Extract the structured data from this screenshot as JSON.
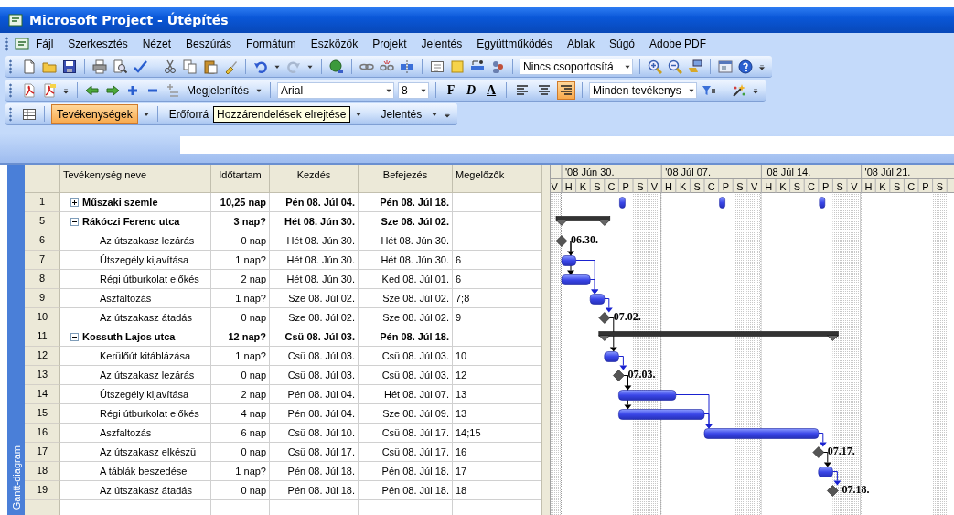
{
  "window": {
    "title": "Microsoft Project - Útépítés"
  },
  "menu": [
    "Fájl",
    "Szerkesztés",
    "Nézet",
    "Beszúrás",
    "Formátum",
    "Eszközök",
    "Projekt",
    "Jelentés",
    "Együttműködés",
    "Ablak",
    "Súgó",
    "Adobe PDF"
  ],
  "toolbar_standard": {
    "grouping": "Nincs csoportosítá"
  },
  "toolbar_formatting": {
    "show_button": "Megjelenítés",
    "font": "Arial",
    "size": "8",
    "style_buttons": [
      "F",
      "D",
      "A"
    ],
    "align_buttons": [
      {
        "selected": false
      },
      {
        "selected": false
      },
      {
        "selected": true
      }
    ],
    "filter": "Minden tevékenys"
  },
  "toolbar_views": {
    "tabs": [
      {
        "label": "Tevékenységek",
        "selected": true
      },
      {
        "label": "Erőforrá",
        "selected": false
      },
      {
        "label": "Jelentés",
        "selected": false
      }
    ],
    "tooltip": "Hozzárendelések elrejtése"
  },
  "view_bar": {
    "label": "Gantt-diagram"
  },
  "table": {
    "columns": [
      "Tevékenység neve",
      "Időtartam",
      "Kezdés",
      "Befejezés",
      "Megelőzők"
    ],
    "rows": [
      {
        "id": "1",
        "kind": "recurring",
        "expanded": false,
        "name": "Műszaki szemle",
        "duration": "10,25 nap",
        "start": "Pén 08. Júl 04.",
        "finish": "Pén 08. Júl 18."
      },
      {
        "id": "5",
        "kind": "summary",
        "expanded": true,
        "name": "Rákóczi Ferenc utca",
        "duration": "3 nap?",
        "start": "Hét 08. Jún 30.",
        "finish": "Sze 08. Júl 02."
      },
      {
        "id": "6",
        "kind": "milestone",
        "name": "Az útszakasz lezárás",
        "duration": "0 nap",
        "start": "Hét 08. Jún 30.",
        "finish": "Hét 08. Jún 30.",
        "label": "06.30."
      },
      {
        "id": "7",
        "kind": "task",
        "name": "Útszegély kijavítása",
        "duration": "1 nap?",
        "start": "Hét 08. Jún 30.",
        "finish": "Hét 08. Jún 30.",
        "predecessors": "6"
      },
      {
        "id": "8",
        "kind": "task",
        "name": "Régi útburkolat előkés",
        "duration": "2 nap",
        "start": "Hét 08. Jún 30.",
        "finish": "Ked 08. Júl 01.",
        "predecessors": "6"
      },
      {
        "id": "9",
        "kind": "task",
        "name": "Aszfaltozás",
        "duration": "1 nap?",
        "start": "Sze 08. Júl 02.",
        "finish": "Sze 08. Júl 02.",
        "predecessors": "7;8"
      },
      {
        "id": "10",
        "kind": "milestone",
        "name": "Az útszakasz átadás",
        "duration": "0 nap",
        "start": "Sze 08. Júl 02.",
        "finish": "Sze 08. Júl 02.",
        "predecessors": "9",
        "label": "07.02."
      },
      {
        "id": "11",
        "kind": "summary",
        "expanded": true,
        "name": "Kossuth Lajos utca",
        "duration": "12 nap?",
        "start": "Csü 08. Júl 03.",
        "finish": "Pén 08. Júl 18."
      },
      {
        "id": "12",
        "kind": "task",
        "name": "Kerülőút kitáblázása",
        "duration": "1 nap?",
        "start": "Csü 08. Júl 03.",
        "finish": "Csü 08. Júl 03.",
        "predecessors": "10"
      },
      {
        "id": "13",
        "kind": "milestone",
        "name": "Az útszakasz lezárás",
        "duration": "0 nap",
        "start": "Csü 08. Júl 03.",
        "finish": "Csü 08. Júl 03.",
        "predecessors": "12",
        "label": "07.03."
      },
      {
        "id": "14",
        "kind": "task",
        "name": "Útszegély kijavítása",
        "duration": "2 nap",
        "start": "Pén 08. Júl 04.",
        "finish": "Hét 08. Júl 07.",
        "predecessors": "13"
      },
      {
        "id": "15",
        "kind": "task",
        "name": "Régi útburkolat előkés",
        "duration": "4 nap",
        "start": "Pén 08. Júl 04.",
        "finish": "Sze 08. Júl 09.",
        "predecessors": "13"
      },
      {
        "id": "16",
        "kind": "task",
        "name": "Aszfaltozás",
        "duration": "6 nap",
        "start": "Csü 08. Júl 10.",
        "finish": "Csü 08. Júl 17.",
        "predecessors": "14;15"
      },
      {
        "id": "17",
        "kind": "milestone",
        "name": "Az útszakasz elkészü",
        "duration": "0 nap",
        "start": "Csü 08. Júl 17.",
        "finish": "Csü 08. Júl 17.",
        "predecessors": "16",
        "label": "07.17."
      },
      {
        "id": "18",
        "kind": "task",
        "name": "A táblák beszedése",
        "duration": "1 nap?",
        "start": "Pén 08. Júl 18.",
        "finish": "Pén 08. Júl 18.",
        "predecessors": "17"
      },
      {
        "id": "19",
        "kind": "milestone",
        "name": "Az útszakasz átadás",
        "duration": "0 nap",
        "start": "Pén 08. Júl 18.",
        "finish": "Pén 08. Júl 18.",
        "predecessors": "18",
        "label": "07.18."
      }
    ]
  },
  "gantt": {
    "weeks": [
      "'08 Jún 30.",
      "'08 Júl 07.",
      "'08 Júl 14.",
      "'08 Júl 21."
    ],
    "days": [
      "V",
      "H",
      "K",
      "S",
      "C",
      "P",
      "S",
      "V",
      "H",
      "K",
      "S",
      "C",
      "P",
      "S",
      "V",
      "H",
      "K",
      "S",
      "C",
      "P",
      "S",
      "V",
      "H",
      "K",
      "S",
      "C",
      "P",
      "S"
    ]
  }
}
